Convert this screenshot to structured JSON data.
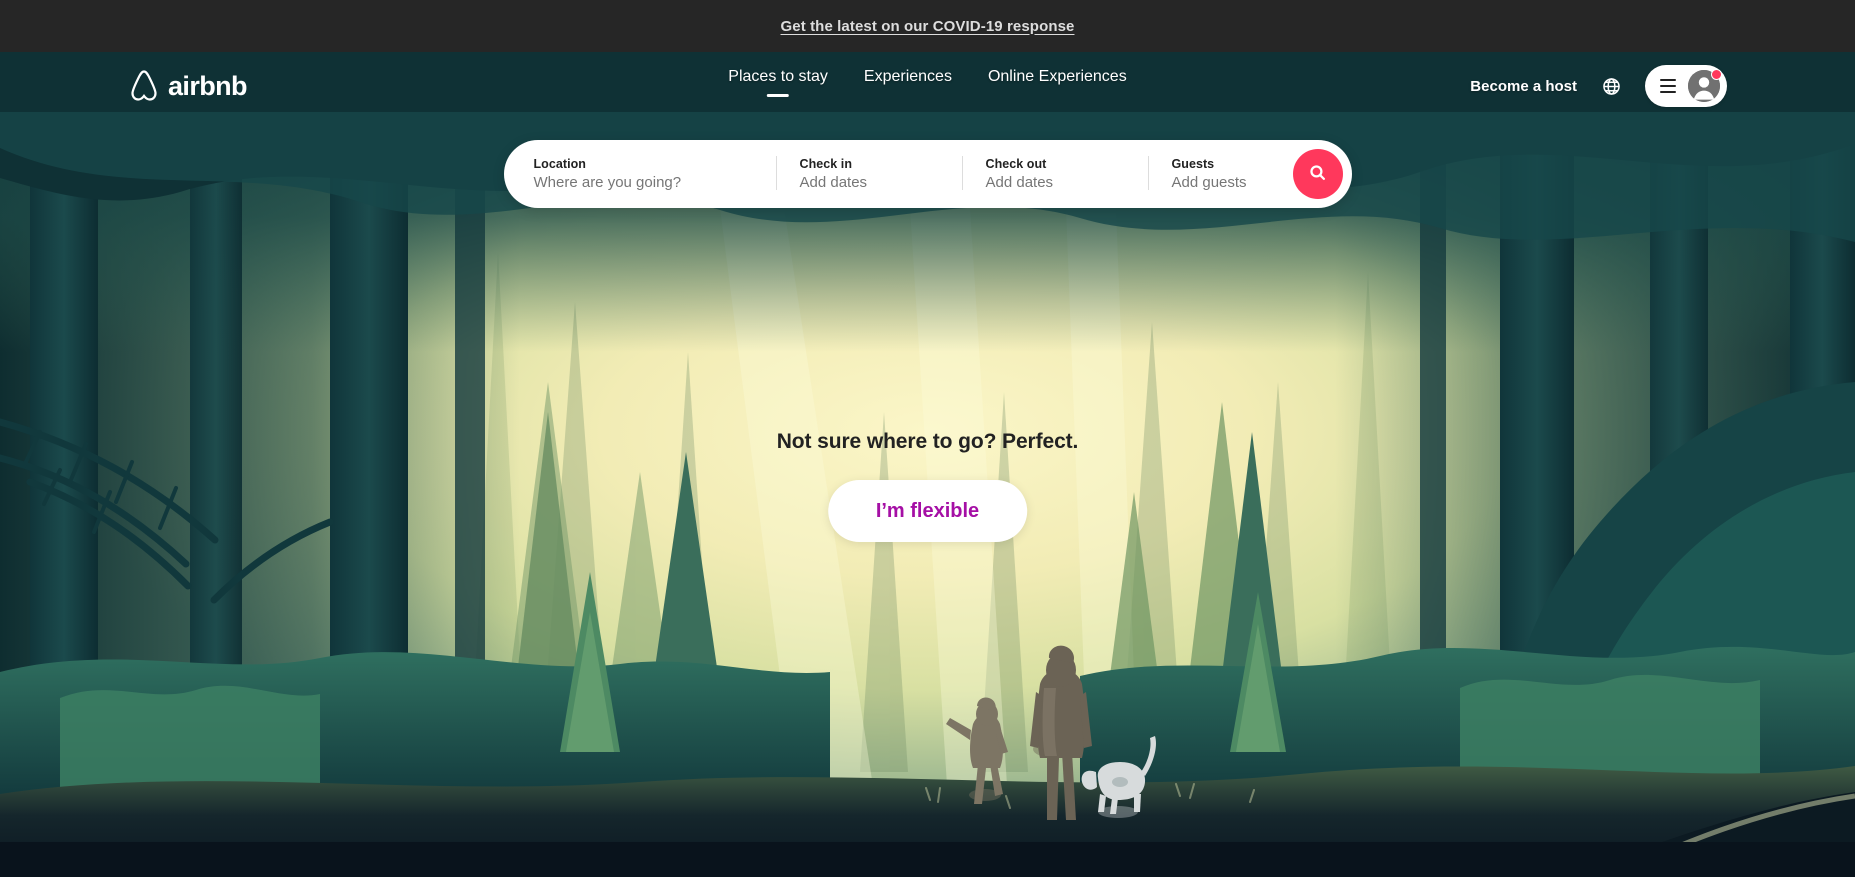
{
  "banner": {
    "link_text": "Get the latest on our COVID-19 response"
  },
  "header": {
    "logo_word": "airbnb",
    "logo_icon": "airbnb-bélo-icon",
    "nav": [
      {
        "label": "Places to stay",
        "active": true
      },
      {
        "label": "Experiences",
        "active": false
      },
      {
        "label": "Online Experiences",
        "active": false
      }
    ],
    "become_host_label": "Become a host",
    "globe_icon": "globe-icon",
    "menu_icon": "hamburger-icon",
    "avatar_icon": "user-avatar-icon",
    "notification_badge": true
  },
  "search": {
    "fields": [
      {
        "label": "Location",
        "value": "Where are you going?"
      },
      {
        "label": "Check in",
        "value": "Add dates"
      },
      {
        "label": "Check out",
        "value": "Add dates"
      },
      {
        "label": "Guests",
        "value": "Add guests"
      }
    ],
    "search_icon": "magnifier-icon"
  },
  "hero": {
    "tagline": "Not sure where to go? Perfect.",
    "cta_label": "I’m flexible",
    "scene": "sunlit-forest-illustration-with-adult-child-and-dog"
  },
  "colors": {
    "brand_red": "#FF385C",
    "banner_bg": "#262626",
    "cta_purple": "#A50FA5",
    "forest_dark_teal": "#123538",
    "forest_light": "#f2eec0",
    "text_dark": "#222222",
    "text_muted": "#767676"
  }
}
